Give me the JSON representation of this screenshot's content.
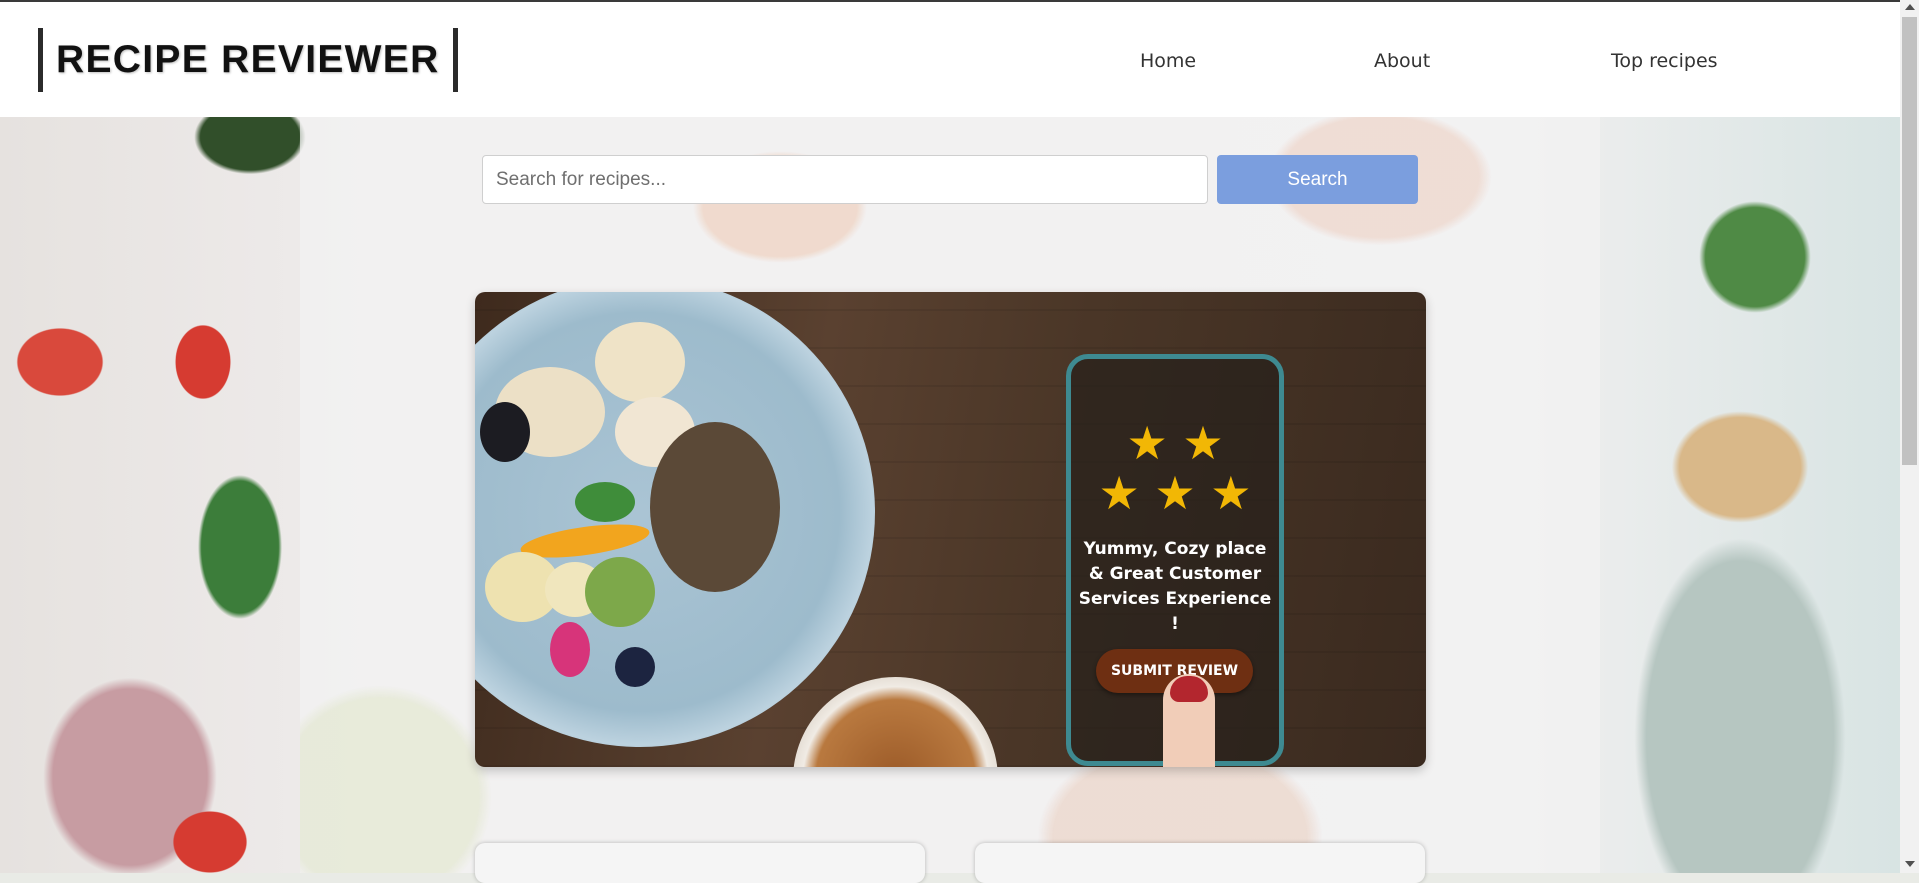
{
  "header": {
    "logo": "RECIPE REVIEWER",
    "nav": [
      {
        "label": "Home"
      },
      {
        "label": "About"
      },
      {
        "label": "Top recipes"
      }
    ]
  },
  "search": {
    "placeholder": "Search for recipes...",
    "button_label": "Search"
  },
  "hero": {
    "rating_stars": 5,
    "star_glyph": "★",
    "review_text": "Yummy, Cozy place & Great Customer Services Experience !",
    "review_lines": [
      "Yummy, Cozy place",
      "& Great Customer",
      "Services Experience !"
    ],
    "submit_label": "SUBMIT REVIEW"
  },
  "colors": {
    "search_button": "#7b9ede",
    "submit_button": "#6e2f12",
    "phone_border": "#3e8a91",
    "star": "#f2b705"
  }
}
